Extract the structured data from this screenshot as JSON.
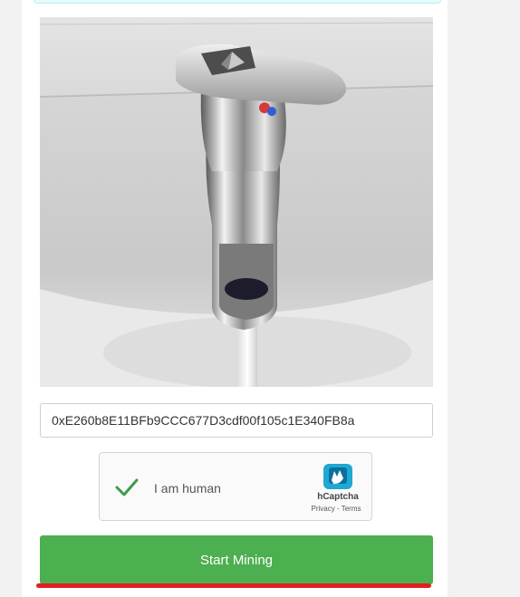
{
  "wallet": {
    "address_value": "0xE260b8E11BFb9CCC677D3cdf00f105c1E340FB8a"
  },
  "captcha": {
    "label": "I am human",
    "brand": "hCaptcha",
    "links": "Privacy - Terms",
    "checked": true,
    "check_color": "#3c9b4a",
    "logo_color": "#1fa8d1"
  },
  "actions": {
    "start_label": "Start Mining",
    "button_color": "#4caf50"
  },
  "image": {
    "subject": "chrome faucet with ethereum logo",
    "logo_icon": "ethereum-logo-icon"
  },
  "highlight_color": "#e02020"
}
